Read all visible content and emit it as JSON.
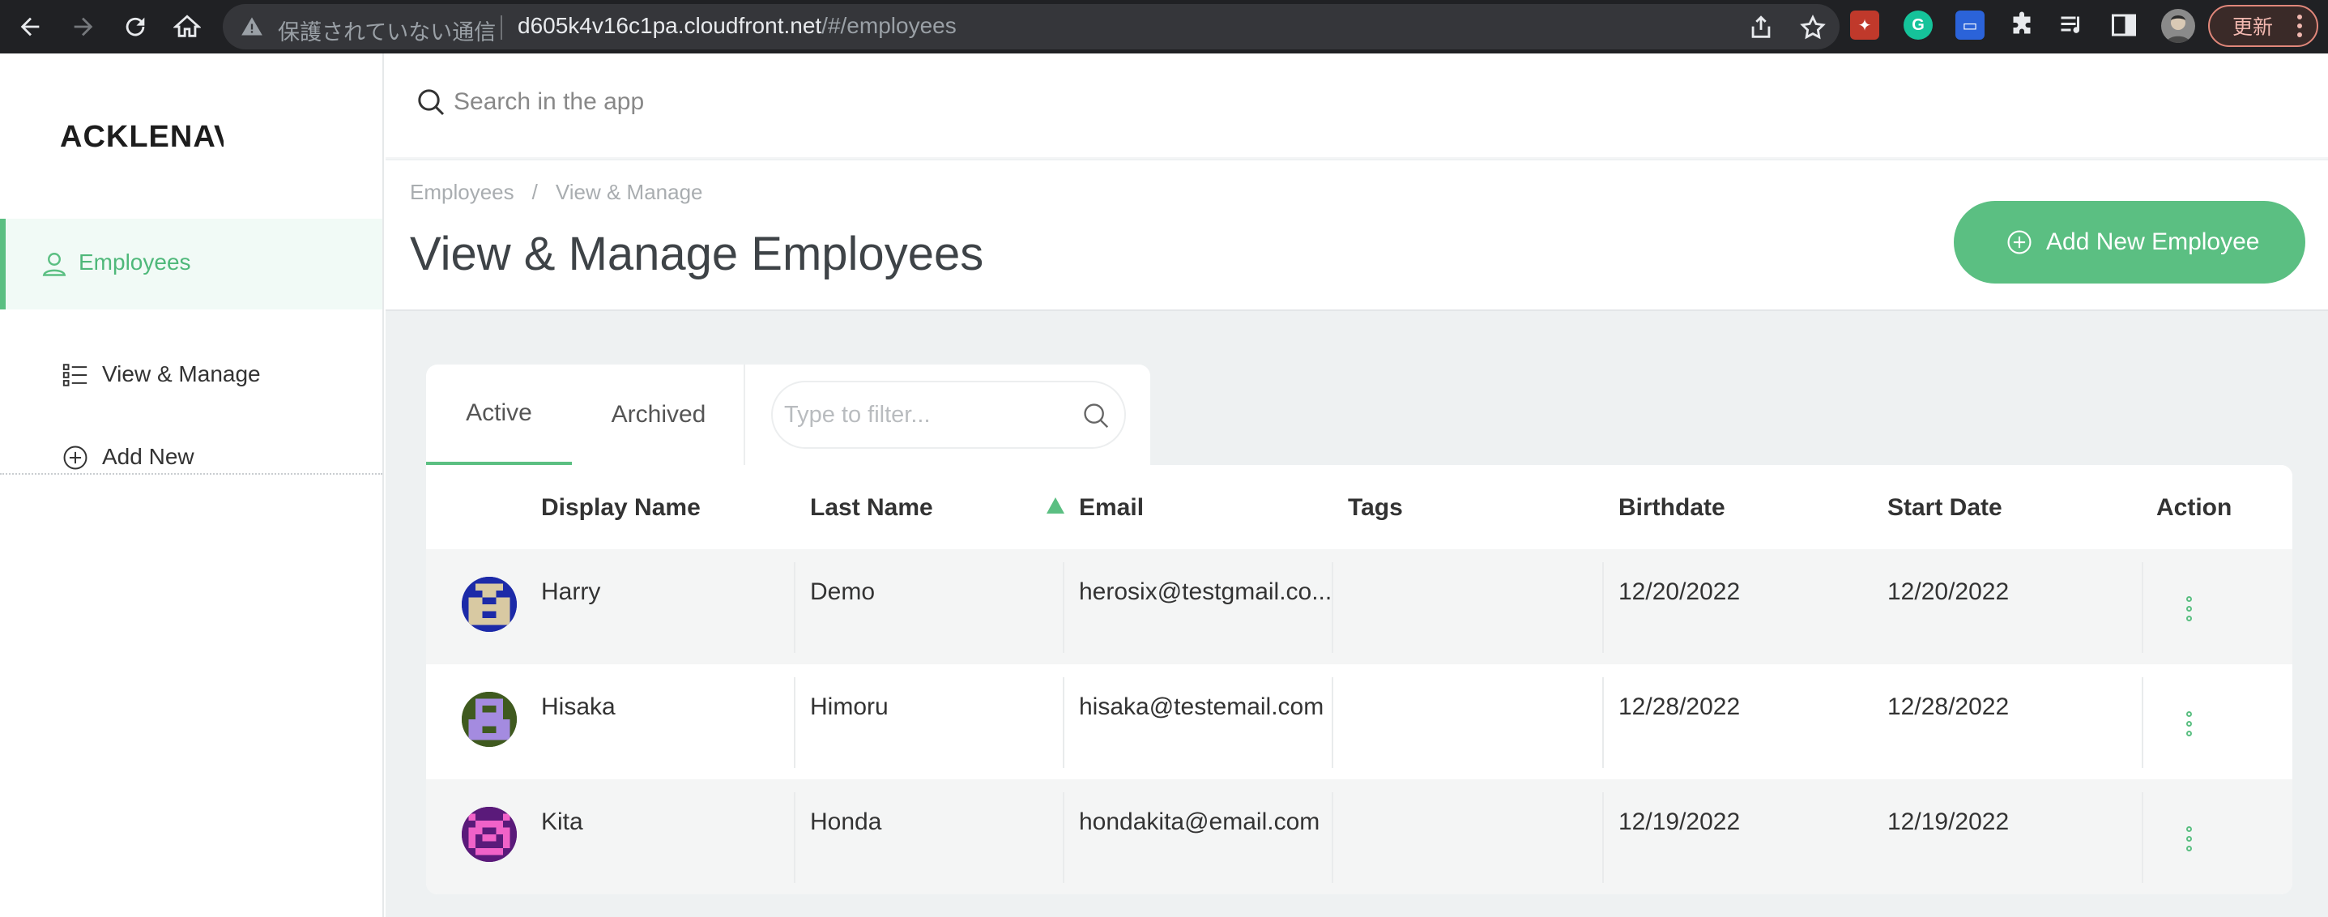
{
  "browser": {
    "security_label": "保護されていない通信",
    "url_host": "d605k4v16c1pa.cloudfront.net",
    "url_path": "/#/employees",
    "update_label": "更新"
  },
  "sidebar": {
    "logo": "ACKLENAV",
    "section": {
      "label": "Employees",
      "icon": "user-icon"
    },
    "items": [
      {
        "label": "View & Manage",
        "icon": "list-icon"
      },
      {
        "label": "Add New",
        "icon": "plus-circle-icon"
      }
    ]
  },
  "search": {
    "placeholder": "Search in the app"
  },
  "header": {
    "breadcrumb": [
      "Employees",
      "View & Manage"
    ],
    "breadcrumb_sep": "/",
    "title": "View & Manage Employees",
    "add_button": "Add New Employee"
  },
  "tabs": {
    "active": "Active",
    "archived": "Archived"
  },
  "filter": {
    "placeholder": "Type to filter..."
  },
  "table": {
    "columns": {
      "display_name": "Display Name",
      "last_name": "Last Name",
      "email": "Email",
      "tags": "Tags",
      "birthdate": "Birthdate",
      "start_date": "Start Date",
      "action": "Action"
    },
    "sorted_column": "Email",
    "rows": [
      {
        "display_name": "Harry",
        "last_name": "Demo",
        "email": "herosix@testgmail.co...",
        "tags": "",
        "birthdate": "12/20/2022",
        "start_date": "12/20/2022"
      },
      {
        "display_name": "Hisaka",
        "last_name": "Himoru",
        "email": "hisaka@testemail.com",
        "tags": "",
        "birthdate": "12/28/2022",
        "start_date": "12/28/2022"
      },
      {
        "display_name": "Kita",
        "last_name": "Honda",
        "email": "hondakita@email.com",
        "tags": "",
        "birthdate": "12/19/2022",
        "start_date": "12/19/2022"
      }
    ]
  },
  "colors": {
    "accent": "#5bbf82",
    "chrome_bg": "#202124",
    "page_bg": "#eef1f2"
  }
}
